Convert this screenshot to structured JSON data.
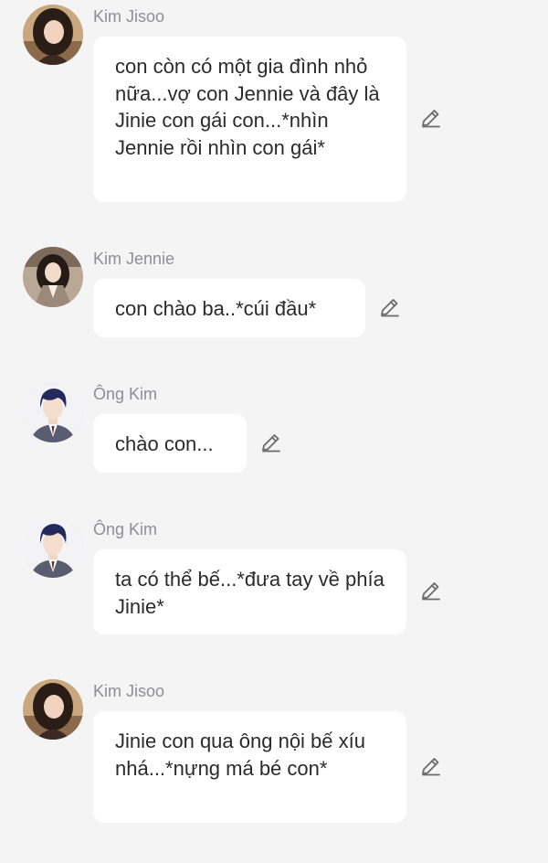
{
  "messages": [
    {
      "sender": "Kim Jisoo",
      "avatar_icon": "woman-dark-hair-avatar",
      "text": "con còn có một gia đình nhỏ nữa...vợ con Jennie và đây là Jinie con gái con...*nhìn Jennie rồi nhìn con gái*",
      "edit_icon": "pencil-icon"
    },
    {
      "sender": "Kim Jennie",
      "avatar_icon": "woman-blazer-avatar",
      "text": "con chào ba..*cúi đầu*",
      "edit_icon": "pencil-icon"
    },
    {
      "sender": "Ông Kim",
      "avatar_icon": "man-navy-hair-avatar",
      "text": "chào con...",
      "edit_icon": "pencil-icon"
    },
    {
      "sender": "Ông Kim",
      "avatar_icon": "man-navy-hair-avatar",
      "text": "ta có thể bế...*đưa tay về phía Jinie*",
      "edit_icon": "pencil-icon"
    },
    {
      "sender": "Kim Jisoo",
      "avatar_icon": "woman-dark-hair-avatar",
      "text": "Jinie con qua ông nội bế xíu nhá...*nựng má bé con*",
      "edit_icon": "pencil-icon"
    }
  ],
  "colors": {
    "background": "#f4f4f5",
    "bubble": "#ffffff",
    "text": "#2b2b2b",
    "sender_name": "#8e8e93",
    "edit_icon": "#6b6b6b"
  }
}
